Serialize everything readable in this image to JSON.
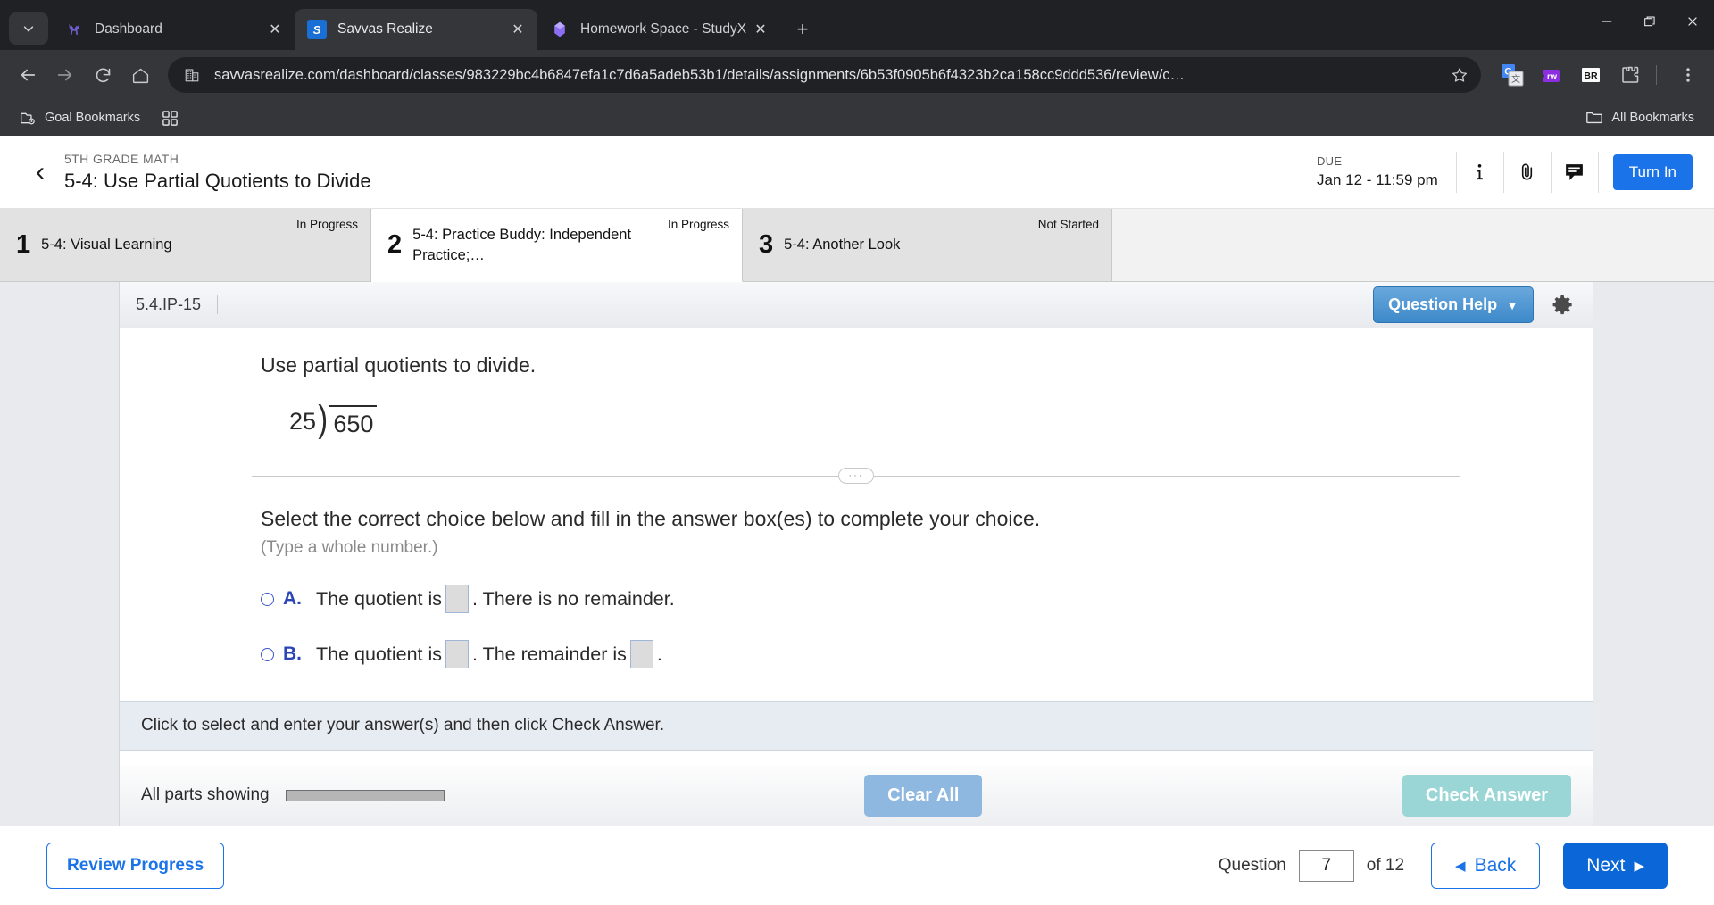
{
  "browser": {
    "tabs": [
      {
        "title": "Dashboard",
        "favicon": "deer-icon",
        "active": false,
        "close_label": "✕"
      },
      {
        "title": "Savvas Realize",
        "favicon": "savvas-s-icon",
        "active": true,
        "close_label": "✕"
      },
      {
        "title": "Homework Space - StudyX",
        "favicon": "studyx-icon",
        "active": false,
        "close_label": "✕"
      }
    ],
    "new_tab_label": "+",
    "window_controls": {
      "minimize": "—",
      "maximize": "❐",
      "close": "✕"
    },
    "nav": {
      "back": "←",
      "forward": "→",
      "reload": "↻",
      "home": "⌂"
    },
    "omnibox": {
      "url": "savvasrealize.com/dashboard/classes/983229bc4b6847efa1c7d6a5adeb53b1/details/assignments/6b53f0905b6f4323b2ca158cc9ddd536/review/c…",
      "site_icon": "site-info-icon",
      "star_icon": "☆"
    },
    "extensions": [
      {
        "name": "google-translate-icon",
        "label": "G"
      },
      {
        "name": "read-write-icon",
        "label": "rw"
      },
      {
        "name": "br-extension-icon",
        "label": "BR"
      },
      {
        "name": "extensions-puzzle-icon",
        "label": ""
      }
    ],
    "menu_icon": "⋮",
    "bookmarks": {
      "items": [
        {
          "label": "Goal Bookmarks",
          "icon": "folder-gear-icon"
        },
        {
          "label": "",
          "icon": "apps-grid-icon"
        }
      ],
      "all_bookmarks_label": "All Bookmarks",
      "all_bookmarks_icon": "folder-icon"
    }
  },
  "app": {
    "header": {
      "back_icon": "‹",
      "course": "5TH GRADE MATH",
      "title": "5-4: Use Partial Quotients to Divide",
      "due_label": "DUE",
      "due_value": "Jan 12 - 11:59 pm",
      "info_icon": "info-icon",
      "attachment_icon": "paperclip-icon",
      "comment_icon": "comment-icon",
      "turn_in_label": "Turn In"
    },
    "steps": [
      {
        "num": "1",
        "label": "5-4: Visual Learning",
        "status": "In Progress",
        "active": false
      },
      {
        "num": "2",
        "label": "5-4: Practice Buddy: Independent Practice;…",
        "status": "In Progress",
        "active": true
      },
      {
        "num": "3",
        "label": "5-4: Another Look",
        "status": "Not Started",
        "active": false
      }
    ],
    "exercise": {
      "id": "5.4.IP-15",
      "question_help_label": "Question Help",
      "question_help_caret": "▼",
      "settings_icon": "gear-icon",
      "prompt": "Use partial quotients to divide.",
      "division": {
        "divisor": "25",
        "bracket": ")",
        "dividend": "650"
      },
      "splitter_dots": "···",
      "choice_instruction": "Select the correct choice below and fill in the answer box(es) to complete your choice.",
      "choice_hint": "(Type a whole number.)",
      "choices": [
        {
          "letter": "A.",
          "text_before": "The quotient is",
          "text_middle": ". There is no remainder.",
          "text_after": "",
          "boxes": 1
        },
        {
          "letter": "B.",
          "text_before": "The quotient is",
          "text_middle": ". The remainder is",
          "text_after": ".",
          "boxes": 2
        }
      ],
      "hint_bar": "Click to select and enter your answer(s) and then click Check Answer.",
      "parts_label": "All parts showing",
      "clear_all_label": "Clear All",
      "check_answer_label": "Check Answer"
    },
    "footer": {
      "review_progress_label": "Review Progress",
      "question_label": "Question",
      "question_value": "7",
      "of_label": "of 12",
      "back_label": "Back",
      "back_arrow": "◀",
      "next_label": "Next",
      "next_arrow": "▶"
    }
  },
  "colors": {
    "chrome_dark": "#202124",
    "chrome_toolbar": "#35363a",
    "accent_blue": "#1a73e8",
    "question_help_blue": "#3d89c9",
    "choice_blue": "#2b45b8",
    "check_answer_teal": "#9ad6d6",
    "clear_all_blue": "#8fb8e0"
  }
}
